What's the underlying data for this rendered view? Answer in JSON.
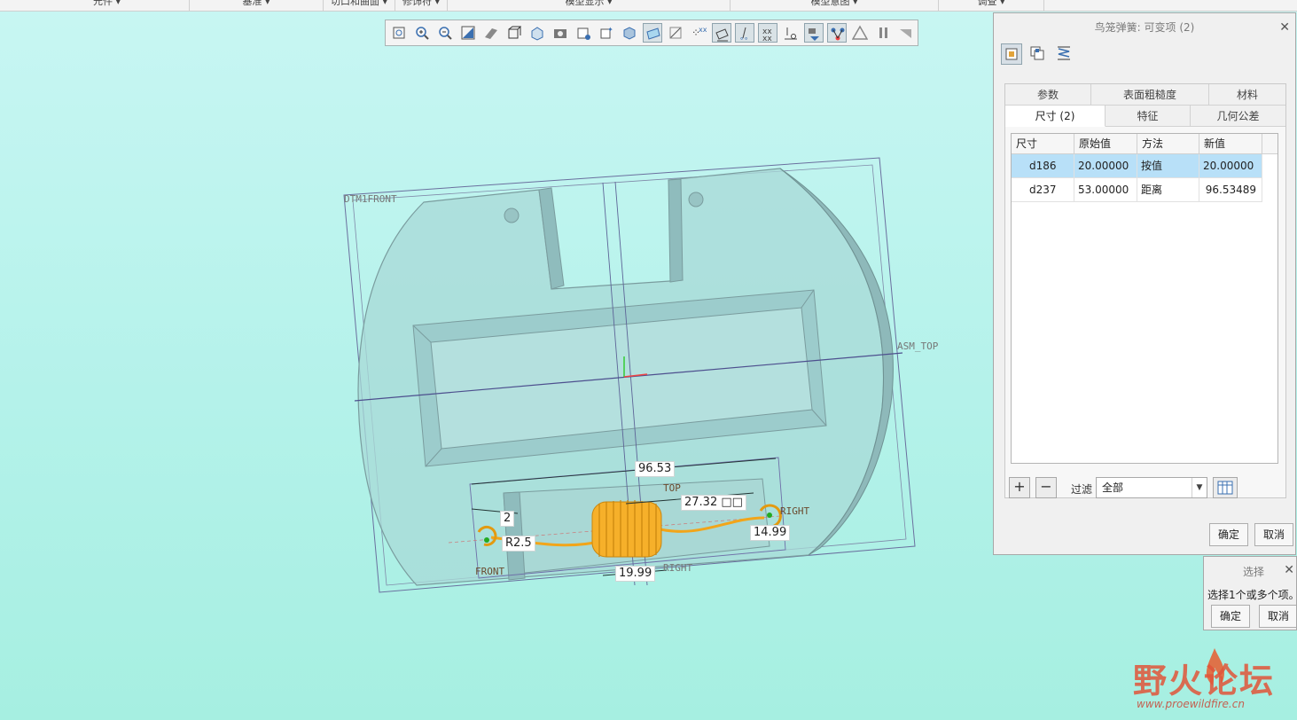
{
  "ribbon": {
    "groups": [
      "元件",
      "基准",
      "切口和曲面",
      "修饰符",
      "模型显示",
      "模型意图",
      "调查"
    ]
  },
  "graphics_toolbar": {
    "icons": [
      "refit-icon",
      "zoom-in-icon",
      "zoom-out-icon",
      "repaint-icon",
      "perspective-icon",
      "display-style-icon",
      "named-views-icon",
      "saved-orientations-icon",
      "view-manager-icon",
      "spin-center-icon",
      "section-icon",
      "datum-display-icon",
      "plane-display-icon",
      "axis-display-icon",
      "point-display-icon",
      "csys-display-icon",
      "annotation-display-icon",
      "spin-tag-icon",
      "pause-icon",
      "stop-icon"
    ]
  },
  "viewport": {
    "datum_labels": {
      "top_left": "DTM1FRONT",
      "right": "ASM_TOP",
      "top": "TOP",
      "right_small": "RIGHT",
      "front": "FRONT",
      "bottom_right": "RIGHT"
    },
    "dimensions": {
      "d1": "96.53",
      "d2": "27.32",
      "d3": "2",
      "d4": "R2.5",
      "d5": "14.99",
      "d6": "19.99"
    },
    "spring_color": "#f2a51a"
  },
  "dialog": {
    "title": "鸟笼弹簧: 可变项 (2)",
    "tabs_row1": [
      "参数",
      "表面粗糙度",
      "材料"
    ],
    "tabs_row2": [
      "尺寸 (2)",
      "特征",
      "几何公差"
    ],
    "active_tab": "尺寸 (2)",
    "columns": [
      "尺寸",
      "原始值",
      "方法",
      "新值"
    ],
    "rows": [
      {
        "dim": "d186",
        "orig": "20.00000",
        "method": "按值",
        "new": "20.00000"
      },
      {
        "dim": "d237",
        "orig": "53.00000",
        "method": "距离",
        "new": "96.53489"
      }
    ],
    "add_label": "+",
    "remove_label": "−",
    "filter_label": "过滤",
    "filter_value": "全部",
    "ok": "确定",
    "cancel": "取消"
  },
  "selection": {
    "title": "选择",
    "message": "选择1个或多个项。",
    "ok": "确定",
    "cancel": "取消"
  },
  "watermark": {
    "name": "野火论坛",
    "url": "www.proewildfire.cn"
  }
}
